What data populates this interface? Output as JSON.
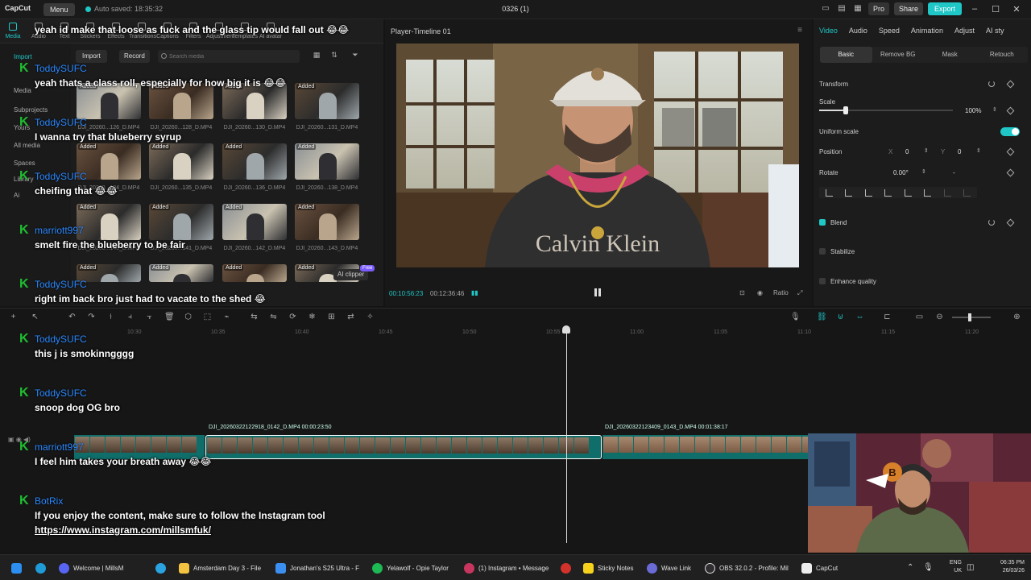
{
  "titlebar": {
    "logo": "CapCut",
    "menu_label": "Menu",
    "autosave": "Auto saved: 18:35:32",
    "project_title": "0326 (1)",
    "pro_label": "Pro",
    "share_label": "Share",
    "export_label": "Export"
  },
  "media": {
    "tools": [
      "Media",
      "Audio",
      "Text",
      "Stickers",
      "Effects",
      "Transitions",
      "Captions",
      "Filters",
      "Adjustment",
      "Templates",
      "AI avatar"
    ],
    "sidebar": [
      "Import",
      "Media",
      "Subprojects",
      "Yours",
      "All media",
      "Spaces",
      "Library",
      "Ai"
    ],
    "import_label": "Import",
    "record_label": "Record",
    "search_placeholder": "Search media",
    "added_label": "Added",
    "thumb_names": [
      "DJI_20260...126_D.MP4",
      "DJI_20260...128_D.MP4",
      "DJI_20260...130_D.MP4",
      "DJI_20260...131_D.MP4",
      "DJI_20260...134_D.MP4",
      "DJI_20260...135_D.MP4",
      "DJI_20260...136_D.MP4",
      "DJI_20260...138_D.MP4",
      "DJI_20260...140_D.MP4",
      "DJI_20260...141_D.MP4",
      "DJI_20260...142_D.MP4",
      "DJI_20260...143_D.MP4"
    ],
    "ai_clipper_label": "AI clipper",
    "free_label": "Free"
  },
  "player": {
    "title": "Player-Timeline 01",
    "current_time": "00:10:56:23",
    "total_time": "00:12:36:46",
    "ratio_label": "Ratio"
  },
  "inspector": {
    "tabs": [
      "Video",
      "Audio",
      "Speed",
      "Animation",
      "Adjust",
      "AI sty"
    ],
    "sub_tabs": [
      "Basic",
      "Remove BG",
      "Mask",
      "Retouch"
    ],
    "transform_label": "Transform",
    "scale_label": "Scale",
    "scale_value": "100%",
    "scale_fraction": 0.2,
    "uniform_scale_label": "Uniform scale",
    "position_label": "Position",
    "pos_x_label": "X",
    "pos_x": "0",
    "pos_y_label": "Y",
    "pos_y": "0",
    "rotate_label": "Rotate",
    "rotate_value": "0.00°",
    "rotate_extra": "-",
    "blend_label": "Blend",
    "stabilize_label": "Stabilize",
    "enhance_label": "Enhance quality"
  },
  "timeline": {
    "ruler_labels": [
      "10:30",
      "10:35",
      "10:40",
      "10:45",
      "10:50",
      "10:55",
      "11:00",
      "11:05",
      "11:10",
      "11:15",
      "11:20"
    ],
    "clip1_label": "DJI_20260322122918_0142_D.MP4   00:00:23:50",
    "clip2_label": "DJI_20260322123409_0143_D.MP4   00:01:38:17"
  },
  "chat": [
    {
      "user": "",
      "text": "yeah id make that loose as fuck and the glass tip would fall out 😂😂"
    },
    {
      "user": "ToddySUFC",
      "text": "yeah thats a class roll, especially for how big it is 😂😂"
    },
    {
      "user": "ToddySUFC",
      "text": "I wanna try that blueberry syrup"
    },
    {
      "user": "ToddySUFC",
      "text": "cheifing that 😂😂"
    },
    {
      "user": "marriott997",
      "text": "smelt fire the blueberry to be fair"
    },
    {
      "user": "ToddySUFC",
      "text": "right im back bro just had to vacate to the shed 😂"
    },
    {
      "user": "ToddySUFC",
      "text": "this j is smokinngggg"
    },
    {
      "user": "ToddySUFC",
      "text": "snoop dog OG bro"
    },
    {
      "user": "marriott997",
      "text": "I feel him takes your breath away 😂😂"
    },
    {
      "user": "BotRix",
      "text": "If you enjoy the content, make sure to follow the Instagram tool",
      "link": "https://www.instagram.com/millsmfuk/"
    }
  ],
  "taskbar": {
    "items": [
      "Welcome | MillsM",
      "Amsterdam Day 3 - File",
      "Jonathan's S25 Ultra - F",
      "Yelawolf - Opie Taylor",
      "(1) Instagram • Message",
      "Sticky Notes",
      "Wave Link",
      "OBS 32.0.2 - Profile: Mil",
      "CapCut"
    ],
    "lang": "ENG",
    "region": "UK",
    "time": "06:35 PM",
    "date": "26/03/26"
  },
  "colors": {
    "accent": "#1fc7c7",
    "chat_user": "#2a88ff",
    "chat_k": "#1fbe30",
    "clip_track": "#0f6e6a"
  }
}
